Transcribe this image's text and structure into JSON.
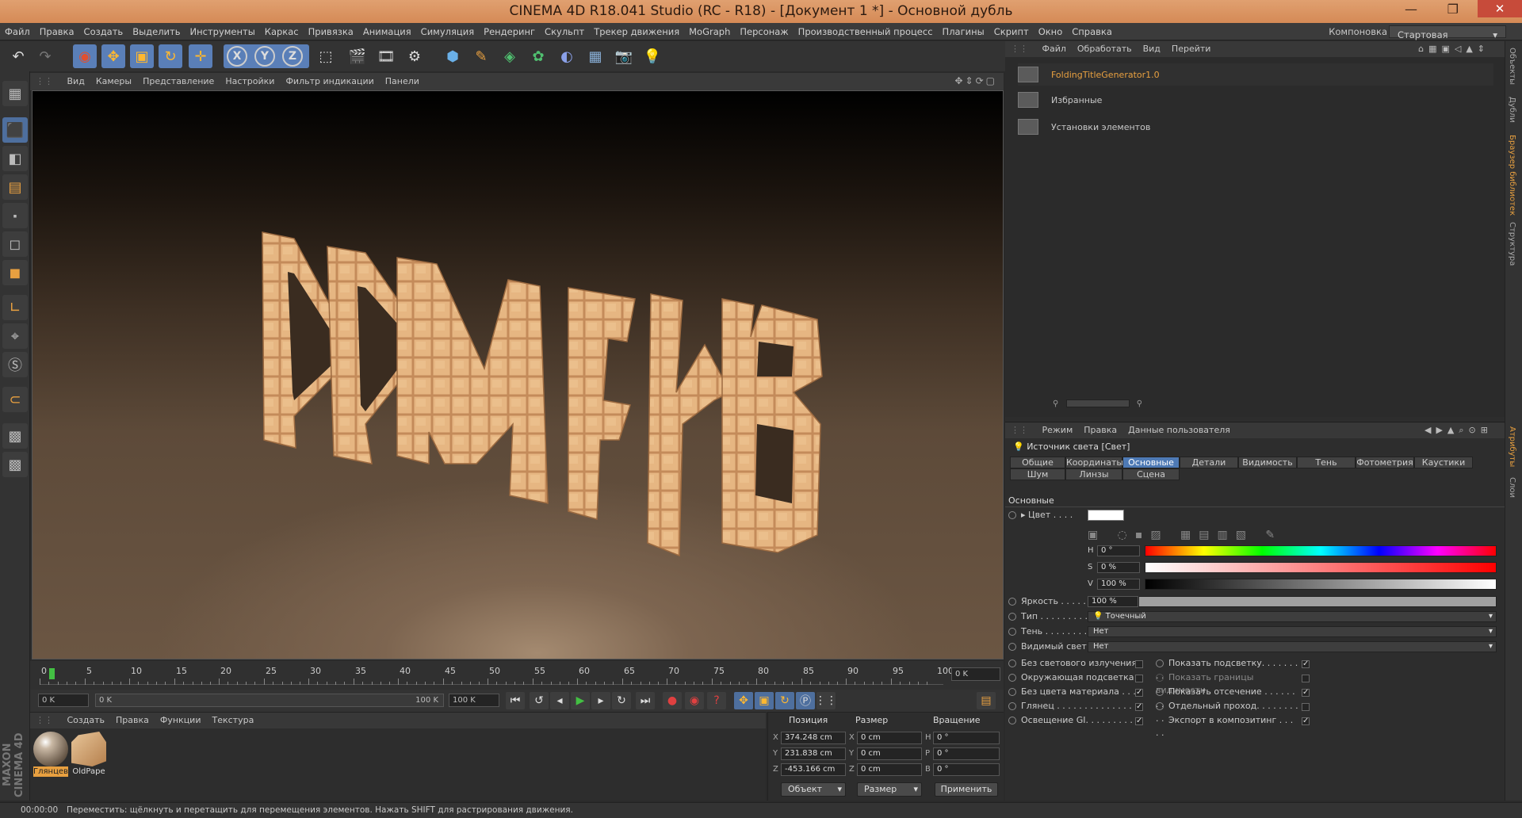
{
  "window": {
    "title": "CINEMA 4D R18.041 Studio (RC - R18) - [Документ 1 *] - Основной дубль"
  },
  "menu": [
    "Файл",
    "Правка",
    "Создать",
    "Выделить",
    "Инструменты",
    "Каркас",
    "Привязка",
    "Анимация",
    "Симуляция",
    "Рендеринг",
    "Скульпт",
    "Трекер движения",
    "MoGraph",
    "Персонаж",
    "Производственный процесс",
    "Плагины",
    "Скрипт",
    "Окно",
    "Справка"
  ],
  "layout": {
    "label": "Компоновка",
    "value": "Стартовая"
  },
  "viewport": {
    "menu": [
      "Вид",
      "Камеры",
      "Представление",
      "Настройки",
      "Фильтр индикации",
      "Панели"
    ]
  },
  "timeline": {
    "ticks": [
      "0",
      "5",
      "10",
      "15",
      "20",
      "25",
      "30",
      "35",
      "40",
      "45",
      "50",
      "55",
      "60",
      "65",
      "70",
      "75",
      "80",
      "85",
      "90",
      "95",
      "100"
    ],
    "end_frame_display": "0 K",
    "start_field": "0 K",
    "range_start": "0 K",
    "range_end": "100 K",
    "end_field": "100 K"
  },
  "materials": {
    "menu": [
      "Создать",
      "Правка",
      "Функции",
      "Текстура"
    ],
    "items": [
      {
        "name": "Глянцев"
      },
      {
        "name": "OldPape"
      }
    ]
  },
  "coords": {
    "headers": {
      "position": "Позиция",
      "size": "Размер",
      "rotation": "Вращение"
    },
    "position": {
      "x": "374.248 cm",
      "y": "231.838 cm",
      "z": "-453.166 cm"
    },
    "size": {
      "x": "0 cm",
      "y": "0 cm",
      "z": "0 cm"
    },
    "rotation": {
      "h": "0 °",
      "p": "0 °",
      "b": "0 °"
    },
    "axis_labels": {
      "x": "X",
      "y": "Y",
      "z": "Z",
      "h": "H",
      "p": "P",
      "b": "B"
    },
    "mode_object": "Объект",
    "mode_size": "Размер",
    "apply": "Применить"
  },
  "status": {
    "time": "00:00:00",
    "text": "Переместить: щёлкнуть и перетащить для перемещения элементов. Нажать SHIFT для растрирования движения."
  },
  "content_browser": {
    "menu": [
      "Файл",
      "Обработать",
      "Вид",
      "Перейти"
    ],
    "items": [
      {
        "label": "FoldingTitleGenerator1.0",
        "highlight": true
      },
      {
        "label": "Избранные"
      },
      {
        "label": "Установки элементов"
      }
    ]
  },
  "attributes": {
    "menu": [
      "Режим",
      "Правка",
      "Данные пользователя"
    ],
    "object_title": "Источник света [Свет]",
    "tabs_row1": [
      "Общие",
      "Координаты",
      "Основные",
      "Детали",
      "Видимость",
      "Тень",
      "Фотометрия",
      "Каустики"
    ],
    "tabs_row2": [
      "Шум",
      "Линзы",
      "Сцена"
    ],
    "active_tab": "Основные",
    "section": "Основные",
    "color_label": "Цвет . . . .",
    "h_label": "H",
    "h_value": "0 °",
    "s_label": "S",
    "s_value": "0 %",
    "v_label": "V",
    "v_value": "100 %",
    "brightness_label": "Яркость . . . . .",
    "brightness_value": "100 %",
    "brightness_level": 1.0,
    "type_label": "Тип . . . . . . . . .",
    "type_value": "Точечный",
    "shadow_label": "Тень . . . . . . . .",
    "shadow_value": "Нет",
    "visible_light_label": "Видимый свет",
    "visible_light_value": "Нет",
    "checks_left": [
      {
        "label": "Без светового излучения",
        "checked": false
      },
      {
        "label": "Окружающая подсветка",
        "checked": false
      },
      {
        "label": "Без цвета материала . . .",
        "checked": true
      },
      {
        "label": "Глянец . . . . . . . . . . . . . .",
        "checked": true
      },
      {
        "label": "Освещение GI. . . . . . . . .",
        "checked": true
      }
    ],
    "checks_right": [
      {
        "label": "Показать подсветку. . . . . . . . .",
        "checked": true
      },
      {
        "label": "Показать границы видимости",
        "checked": false
      },
      {
        "label": "Показать отсечение . . . . . . . .",
        "checked": true
      },
      {
        "label": "Отдельный проход. . . . . . . . . .",
        "checked": false
      },
      {
        "label": "Экспорт в композитинг . . . . .",
        "checked": true
      }
    ]
  },
  "right_strip": [
    "Объекты",
    "Дубли",
    "Браузер библиотек",
    "Структура",
    "Атрибуты",
    "Слои"
  ],
  "colors": {
    "accent": "#4e7ab5",
    "title_bar": "#d58a56",
    "tile": "#e4b27e"
  }
}
